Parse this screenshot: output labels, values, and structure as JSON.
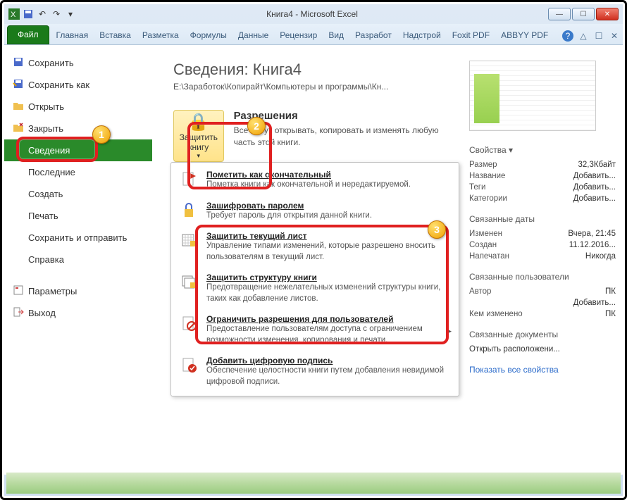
{
  "titlebar": {
    "title": "Книга4  -  Microsoft Excel"
  },
  "ribbon": {
    "file": "Файл",
    "tabs": [
      "Главная",
      "Вставка",
      "Разметка",
      "Формулы",
      "Данные",
      "Рецензир",
      "Вид",
      "Разработ",
      "Надстрой",
      "Foxit PDF",
      "ABBYY PDF"
    ]
  },
  "nav": {
    "save": "Сохранить",
    "saveas": "Сохранить как",
    "open": "Открыть",
    "close": "Закрыть",
    "info": "Сведения",
    "recent": "Последние",
    "new": "Создать",
    "print": "Печать",
    "send": "Сохранить и отправить",
    "help": "Справка",
    "options": "Параметры",
    "exit": "Выход"
  },
  "info": {
    "title": "Сведения: Книга4",
    "path": "E:\\Заработок\\Копирайт\\Компьютеры и программы\\Кн...",
    "permissions_heading": "Разрешения",
    "permissions_text": "Все могут открывать, копировать и изменять любую часть этой книги.",
    "protect_button": "Защитить книгу"
  },
  "protect_menu": {
    "final_title": "Пометить как окончательный",
    "final_desc": "Пометка книги как окончательной и нередактируемой.",
    "encrypt_title": "Зашифровать паролем",
    "encrypt_desc": "Требует пароль для открытия данной книги.",
    "sheet_title": "Защитить текущий лист",
    "sheet_desc": "Управление типами изменений, которые разрешено вносить пользователям в текущий лист.",
    "structure_title": "Защитить структуру книги",
    "structure_desc": "Предотвращение нежелательных изменений структуры книги, таких как добавление листов.",
    "restrict_title": "Ограничить разрешения для пользователей",
    "restrict_desc": "Предоставление пользователям доступа с ограничением возможности изменения, копирования и печати.",
    "signature_title": "Добавить цифровую подпись",
    "signature_desc": "Обеспечение целостности книги путем добавления невидимой цифровой подписи."
  },
  "side": {
    "properties": "Свойства",
    "size_k": "Размер",
    "size_v": "32,3Кбайт",
    "title_k": "Название",
    "add": "Добавить...",
    "tags_k": "Теги",
    "categories_k": "Категории",
    "dates": "Связанные даты",
    "modified_k": "Изменен",
    "modified_v": "Вчера, 21:45",
    "created_k": "Создан",
    "created_v": "11.12.2016...",
    "printed_k": "Напечатан",
    "printed_v": "Никогда",
    "users": "Связанные пользователи",
    "author_k": "Автор",
    "author_v": "ПК",
    "lastmod_k": "Кем изменено",
    "lastmod_v": "ПК",
    "docs": "Связанные документы",
    "openloc": "Открыть расположени...",
    "showall": "Показать все свойства"
  }
}
